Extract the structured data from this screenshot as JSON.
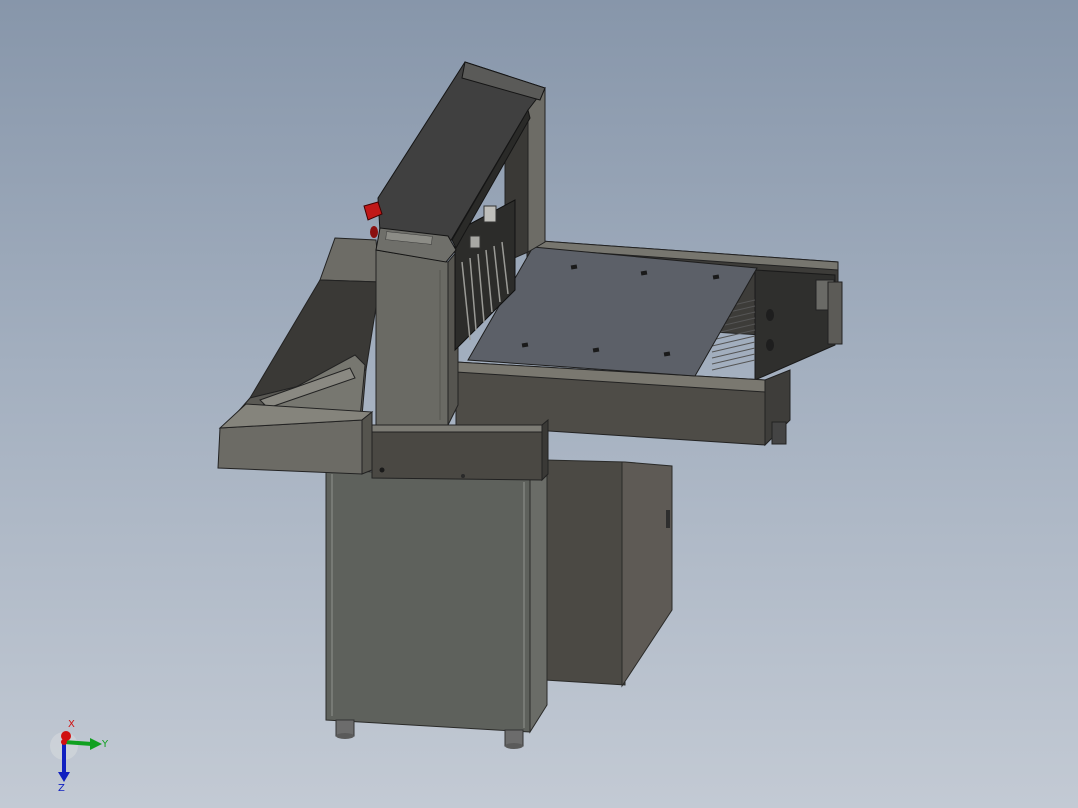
{
  "viewport": {
    "background_top": "#8796aa",
    "background_bottom": "#c3cad4"
  },
  "model": {
    "body_color": "#5b5d58",
    "table_color": "#5a5850",
    "plate_color": "#5c6068",
    "accent_color": "#c01818"
  },
  "triad": {
    "x_label": "X",
    "y_label": "Y",
    "z_label": "Z",
    "x_color": "#d01010",
    "y_color": "#10a020",
    "z_color": "#1020c0"
  }
}
